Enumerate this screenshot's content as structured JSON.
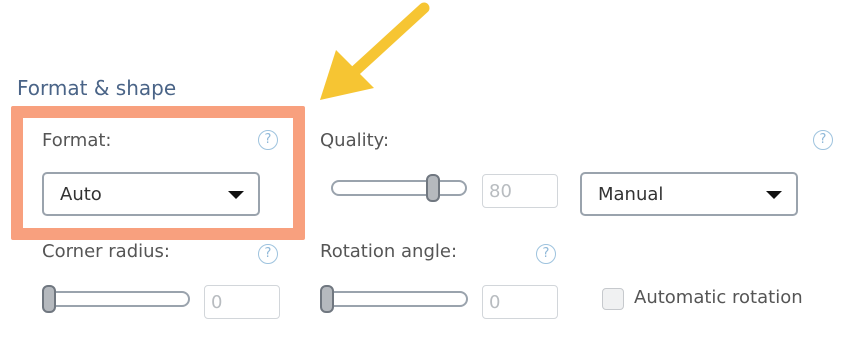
{
  "section": {
    "title": "Format & shape"
  },
  "format": {
    "label": "Format:",
    "value": "Auto",
    "help": "?"
  },
  "quality": {
    "label": "Quality:",
    "value": "80",
    "mode": "Manual",
    "help": "?",
    "slider_level": 0.8
  },
  "corner_radius": {
    "label": "Corner radius:",
    "value": "0",
    "help": "?",
    "slider_level": 0
  },
  "rotation": {
    "label": "Rotation angle:",
    "value": "0",
    "help": "?",
    "slider_level": 0
  },
  "auto_rotation": {
    "label": "Automatic rotation",
    "checked": false
  },
  "colors": {
    "title": "#4a6487",
    "highlight": "#f8a07e",
    "arrow": "#f6c533",
    "help": "#8fb8d8"
  },
  "icons": {
    "help": "question-circle-icon",
    "caret": "caret-down-icon",
    "arrow": "annotation-arrow-icon"
  }
}
